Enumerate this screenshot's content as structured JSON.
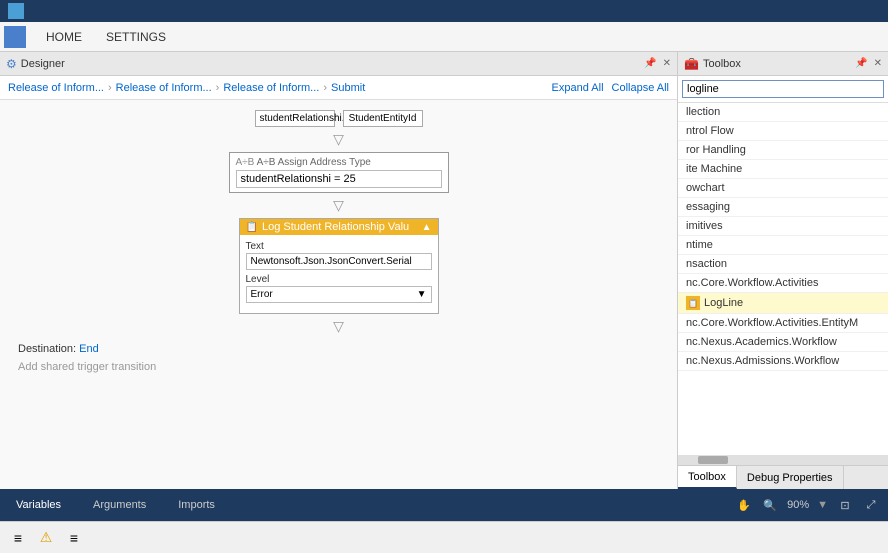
{
  "titlebar": {
    "label": ""
  },
  "menubar": {
    "items": [
      {
        "id": "home",
        "label": "HOME"
      },
      {
        "id": "settings",
        "label": "SETTINGS"
      }
    ]
  },
  "designer": {
    "panel_label": "Designer",
    "pin_icon": "📌",
    "close_icon": "✕",
    "breadcrumb": [
      "Release of Inform...",
      "Release of Inform...",
      "Release of Inform...",
      "Submit"
    ],
    "expand_all": "Expand All",
    "collapse_all": "Collapse All",
    "top_connectors": [
      "studentRelationshi...",
      "StudentEntityId"
    ],
    "assign_box": {
      "header": "A÷B Assign Address Type",
      "row": "studentRelationshi = 25"
    },
    "log_box": {
      "header": "Log Student Relationship Valu",
      "text_label": "Text",
      "text_value": "Newtonsoft.Json.JsonConvert.Serial",
      "level_label": "Level",
      "level_value": "Error"
    },
    "destination_text": "Destination: End",
    "add_trigger_text": "Add shared trigger transition"
  },
  "toolbox": {
    "panel_label": "Toolbox",
    "pin_icon": "📌",
    "close_icon": "✕",
    "search_placeholder": "logline",
    "search_value": "logline",
    "items": [
      {
        "id": "collection",
        "label": "llection",
        "icon": false,
        "highlighted": false
      },
      {
        "id": "control-flow",
        "label": "ntrol Flow",
        "icon": false,
        "highlighted": false
      },
      {
        "id": "error-handling",
        "label": "ror Handling",
        "icon": false,
        "highlighted": false
      },
      {
        "id": "state-machine",
        "label": "ite Machine",
        "icon": false,
        "highlighted": false
      },
      {
        "id": "flowchart",
        "label": "owchart",
        "icon": false,
        "highlighted": false
      },
      {
        "id": "messaging",
        "label": "essaging",
        "icon": false,
        "highlighted": false
      },
      {
        "id": "primitives",
        "label": "imitives",
        "icon": false,
        "highlighted": false
      },
      {
        "id": "runtime",
        "label": "ntime",
        "icon": false,
        "highlighted": false
      },
      {
        "id": "transaction",
        "label": "nsaction",
        "icon": false,
        "highlighted": false
      },
      {
        "id": "mc-core-workflow",
        "label": "nc.Core.Workflow.Activities",
        "icon": false,
        "highlighted": false
      },
      {
        "id": "logline",
        "label": "LogLine",
        "icon": true,
        "highlighted": true
      },
      {
        "id": "mc-core-entity",
        "label": "nc.Core.Workflow.Activities.EntityM",
        "icon": false,
        "highlighted": false
      },
      {
        "id": "mc-nexus-academics",
        "label": "nc.Nexus.Academics.Workflow",
        "icon": false,
        "highlighted": false
      },
      {
        "id": "mc-nexus-admissions",
        "label": "nc.Nexus.Admissions.Workflow",
        "icon": false,
        "highlighted": false
      }
    ],
    "bottom_tabs": [
      "Toolbox",
      "Debug Properties"
    ]
  },
  "bottom_bar": {
    "tabs": [
      "Variables",
      "Arguments",
      "Imports"
    ],
    "zoom_label": "90%",
    "hand_icon": "✋",
    "search_icon": "🔍",
    "fit_icon": "⊡",
    "expand_icon": "⤢"
  },
  "bottom_toolbar": {
    "icons": [
      "≡",
      "⚠",
      "≡"
    ]
  }
}
